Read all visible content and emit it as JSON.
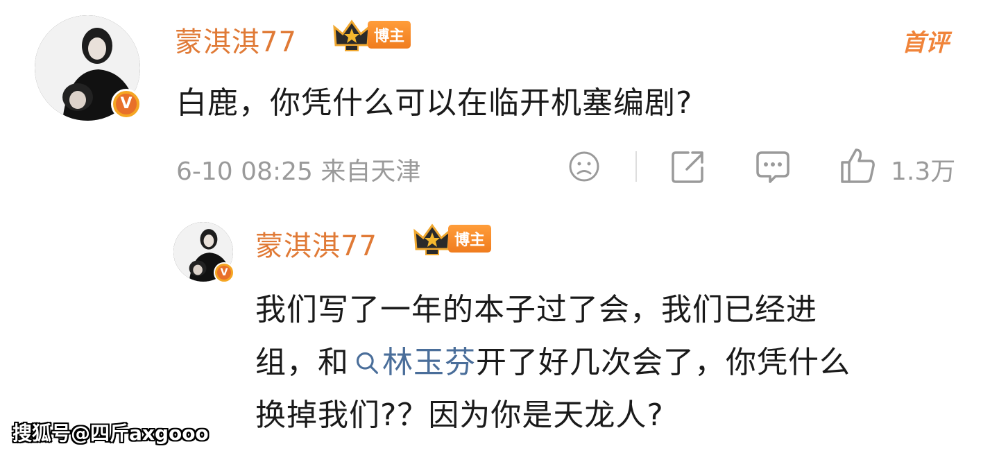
{
  "comment": {
    "user_name": "蒙淇淇77",
    "blogger_tag": "博主",
    "first_comment_badge": "首评",
    "text": "白鹿，你凭什么可以在临开机塞编剧?",
    "time": "6-10 08:25",
    "location": "来自天津",
    "like_count": "1.3万",
    "verified_mark": "V",
    "icons": [
      "sad-face-icon",
      "share-icon",
      "comment-icon",
      "thumbs-up-icon"
    ]
  },
  "reply": {
    "user_name": "蒙淇淇77",
    "blogger_tag": "博主",
    "verified_mark": "V",
    "line1": "我们写了一年的本子过了会，我们已经进",
    "line2_prefix": "组，和",
    "topic": "林玉芬",
    "line2_suffix": "开了好几次会了，你凭什么",
    "line3": "换掉我们?？因为你是天龙人?"
  },
  "watermark": "搜狐号@四斤axgooo",
  "colors": {
    "name": "#e07a36",
    "topic_link": "#4a6e9a",
    "meta_gray": "#9a9a9a",
    "badge_orange": "#f07c1e"
  }
}
